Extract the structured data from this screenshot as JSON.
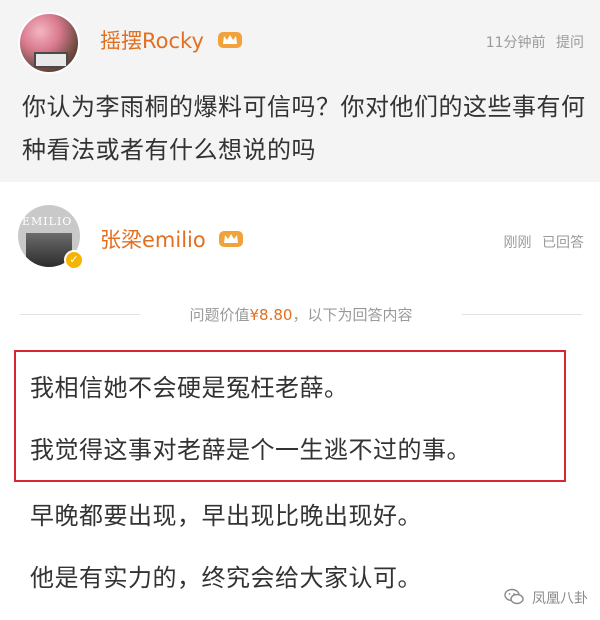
{
  "question": {
    "user_name": "摇摆Rocky",
    "time": "11分钟前",
    "action": "提问",
    "text": "你认为李雨桐的爆料可信吗？你对他们的这些事有何种看法或者有什么想说的吗"
  },
  "answer": {
    "avatar_text": "EMILIO",
    "user_name": "张梁emilio",
    "time": "刚刚",
    "status": "已回答",
    "value_prefix": "问题价值",
    "value_price": "¥8.80",
    "value_suffix": "，以下为回答内容",
    "lines": [
      "我相信她不会硬是冤枉老薛。",
      "我觉得这事对老薛是个一生逃不过的事。",
      "早晚都要出现，早出现比晚出现好。",
      "他是有实力的，终究会给大家认可。"
    ]
  },
  "watermark": "凤凰八卦",
  "colors": {
    "name_orange": "#e26f20",
    "highlight_red": "#d6262f",
    "question_bg": "#f4f4f4",
    "meta_gray": "#9a9a9a"
  },
  "icons": [
    "crown-badge-icon",
    "verified-badge-icon",
    "wechat-icon"
  ]
}
